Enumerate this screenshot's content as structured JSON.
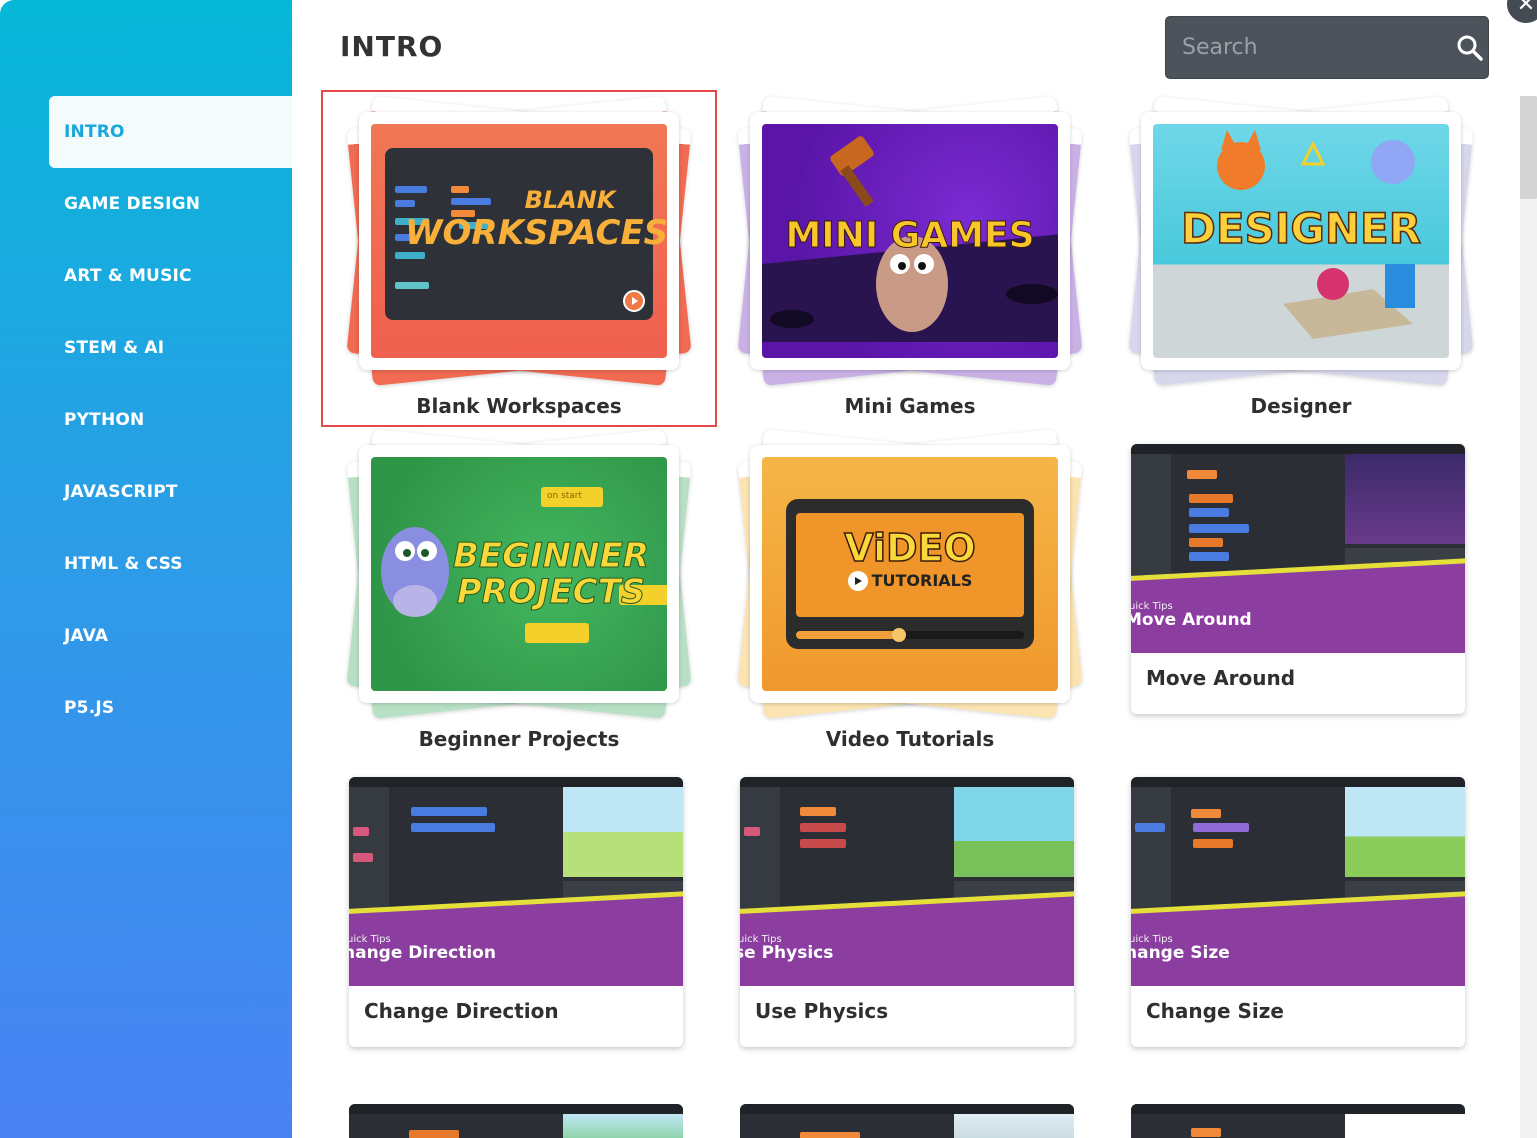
{
  "page_title": "INTRO",
  "search": {
    "placeholder": "Search"
  },
  "close_label": "✕",
  "sidebar": {
    "items": [
      {
        "label": "INTRO",
        "active": true
      },
      {
        "label": "GAME DESIGN"
      },
      {
        "label": "ART & MUSIC"
      },
      {
        "label": "STEM & AI"
      },
      {
        "label": "PYTHON"
      },
      {
        "label": "JAVASCRIPT"
      },
      {
        "label": "HTML & CSS"
      },
      {
        "label": "JAVA"
      },
      {
        "label": "P5.JS"
      }
    ]
  },
  "cards": [
    {
      "label": "Blank Workspaces",
      "art_line1": "BLANK",
      "art_line2": "WORKSPACES",
      "selected": true
    },
    {
      "label": "Mini Games",
      "art": "MINI GAMES"
    },
    {
      "label": "Designer",
      "art": "DESIGNER"
    },
    {
      "label": "Beginner Projects",
      "art_line1": "BEGINNER",
      "art_line2": "PROJECTS",
      "block_text": "on start"
    },
    {
      "label": "Video Tutorials",
      "art_line1": "ViDEO",
      "art_line2": "TUTORIALS"
    }
  ],
  "tiles": [
    {
      "label": "Move Around",
      "qt_small": "uick Tips",
      "qt_big": "Move Around"
    },
    {
      "label": "Change Direction",
      "qt_small": "uick Tips",
      "qt_big": "hange Direction"
    },
    {
      "label": "Use Physics",
      "qt_small": "uick Tips",
      "qt_big": "se Physics"
    },
    {
      "label": "Change Size",
      "qt_small": "uick Tips",
      "qt_big": "hange Size"
    }
  ],
  "colors": {
    "sidebar_top": "#06b8d8",
    "sidebar_bottom": "#4a82f4",
    "active_text": "#1aa7dc",
    "selection_outline": "#e6474b",
    "quick_tips_purple": "#8c3ea0",
    "quick_tips_yellow": "#e5df3a"
  }
}
